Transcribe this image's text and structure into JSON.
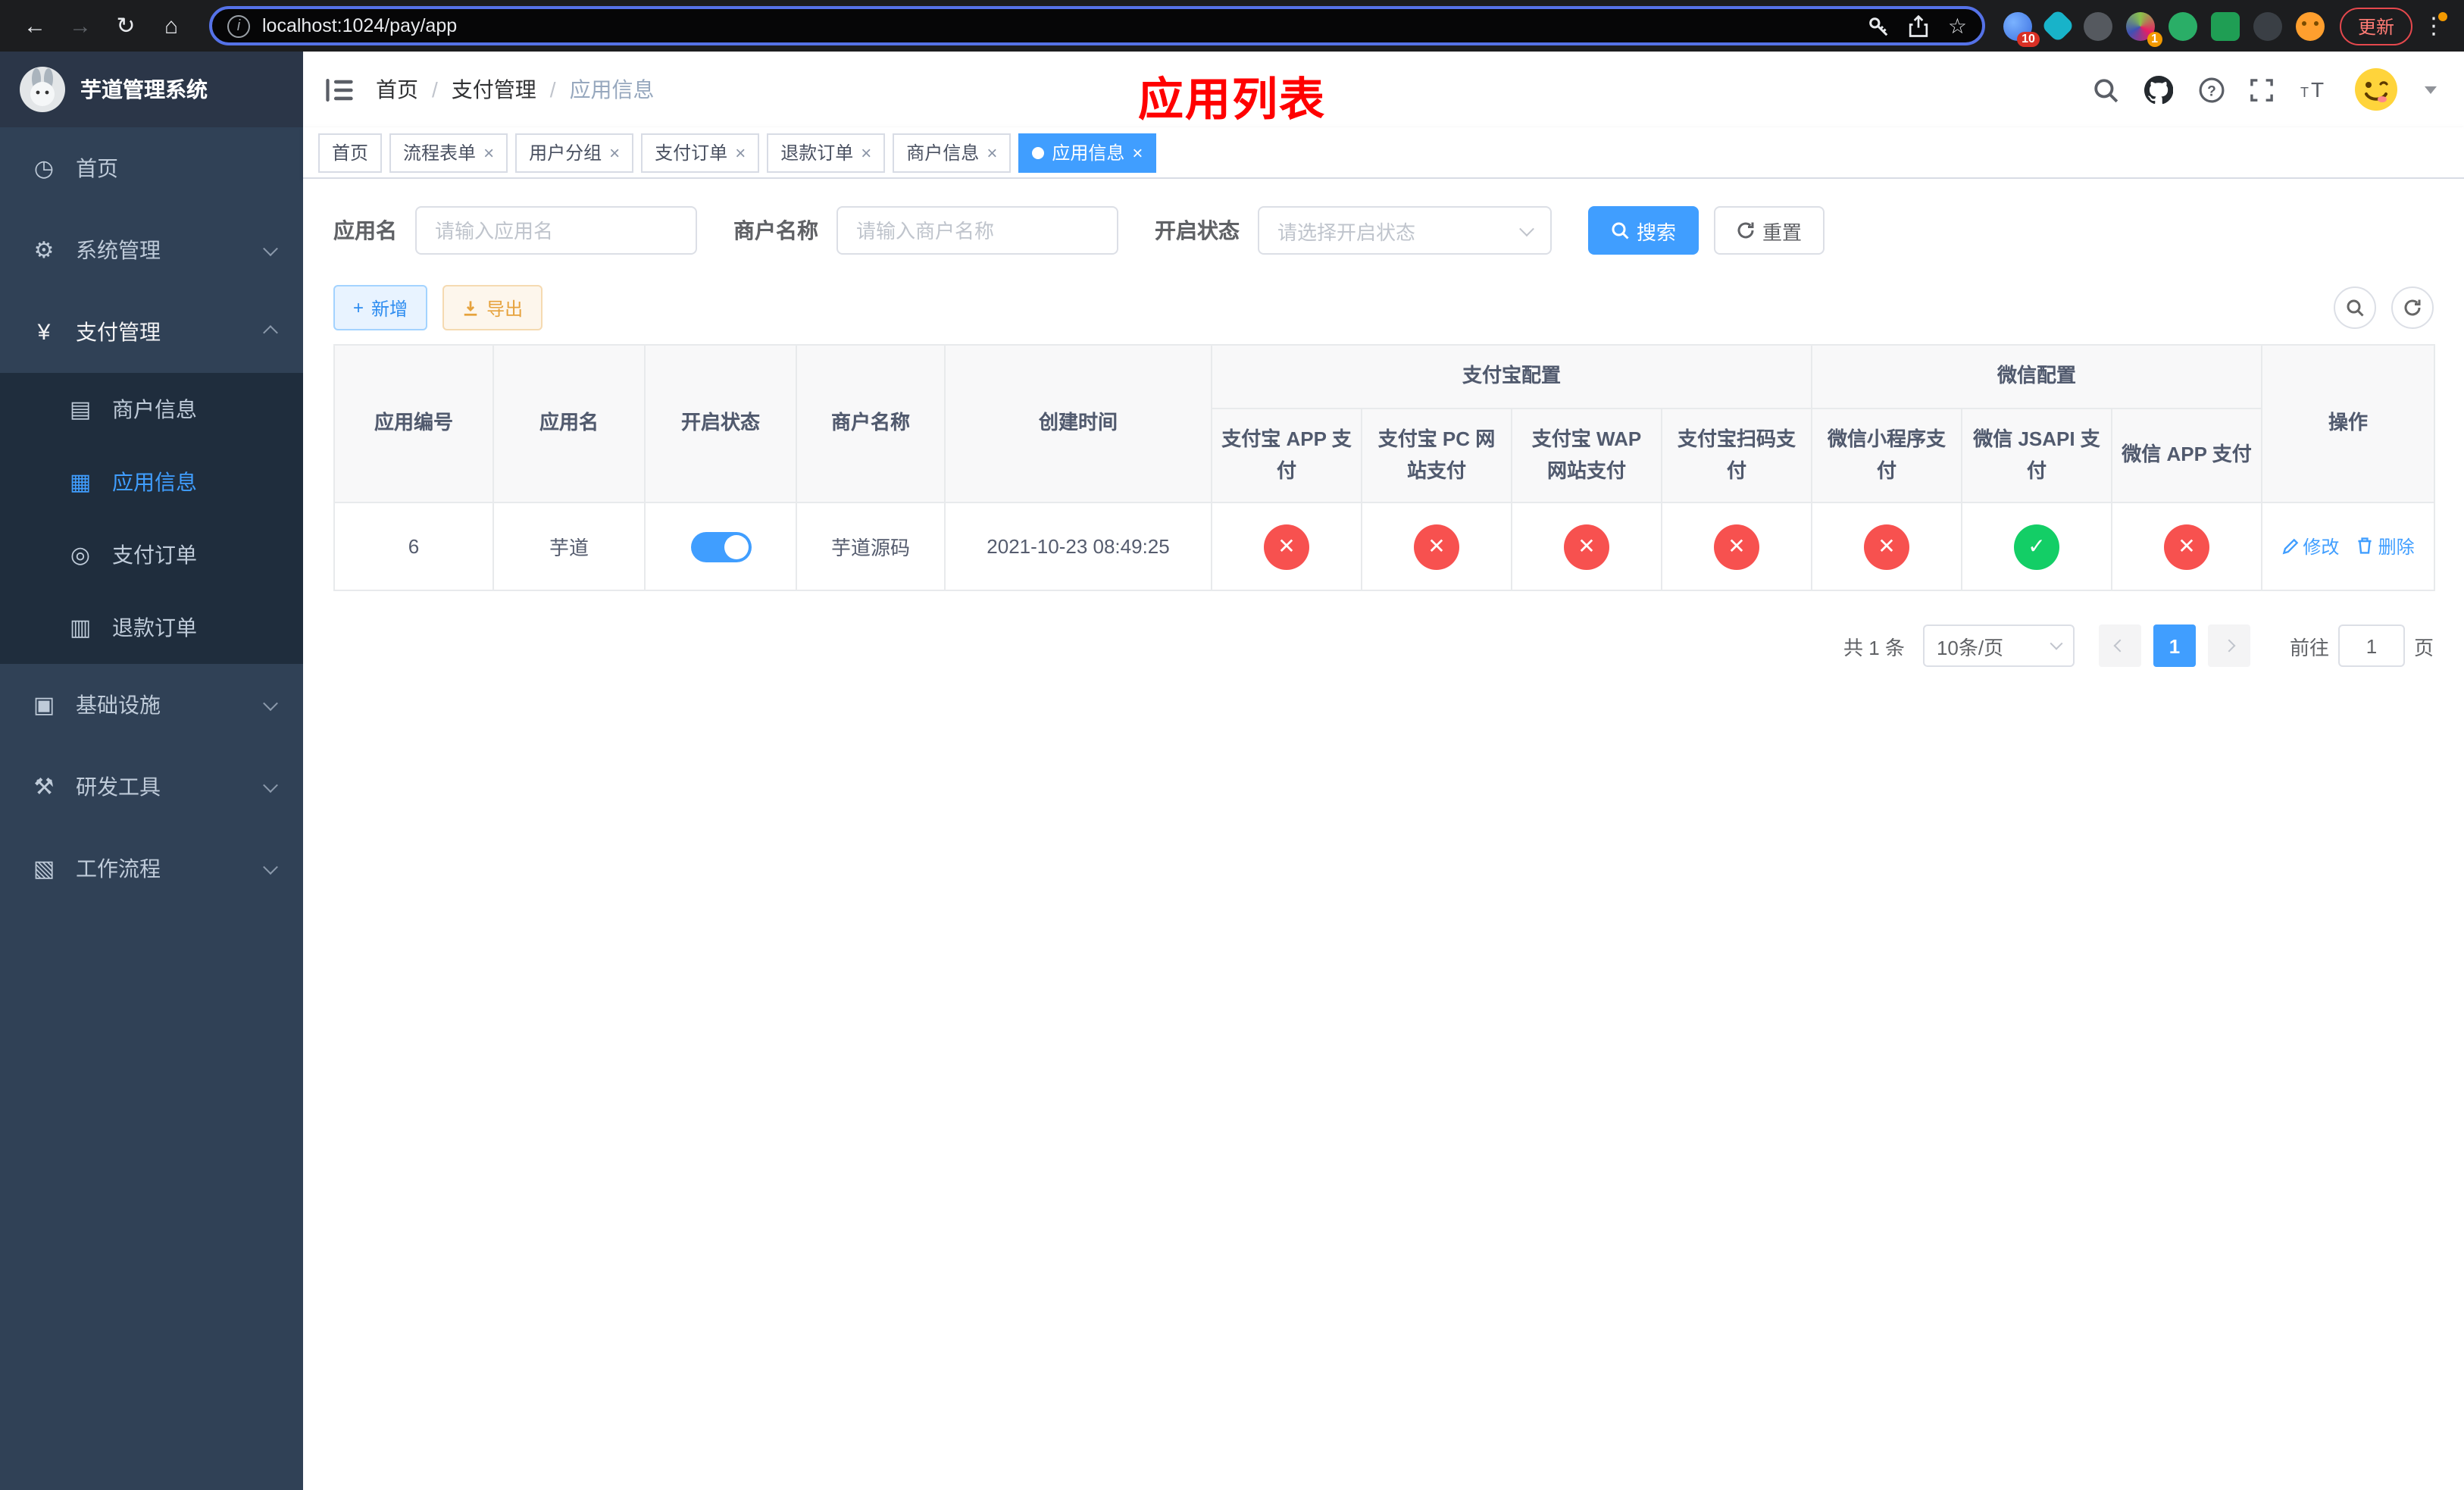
{
  "colors": {
    "primary": "#409eff",
    "success_circle": "#13ce66",
    "danger_circle": "#f7514f",
    "page_title_red": "#ff0000",
    "sidebar_bg": "#304156",
    "submenu_bg": "#1f2d3d",
    "tag_active_bg": "#409eff"
  },
  "browser": {
    "url": "localhost:1024/pay/app",
    "update_label": "更新",
    "extension_badge_1": "10",
    "extension_badge_2": "1"
  },
  "sidebar": {
    "title": "芋道管理系统",
    "items": [
      {
        "label": "首页",
        "icon": "dashboard-icon",
        "glyph": "◷"
      },
      {
        "label": "系统管理",
        "icon": "gear-icon",
        "glyph": "⚙"
      },
      {
        "label": "支付管理",
        "icon": "yen-icon",
        "glyph": "¥",
        "children": [
          {
            "label": "商户信息",
            "icon": "credit-card-icon",
            "glyph": "▤"
          },
          {
            "label": "应用信息",
            "icon": "grid-icon",
            "glyph": "▦"
          },
          {
            "label": "支付订单",
            "icon": "order-icon",
            "glyph": "◎"
          },
          {
            "label": "退款订单",
            "icon": "document-icon",
            "glyph": "▥"
          }
        ]
      },
      {
        "label": "基础设施",
        "icon": "infrastructure-icon",
        "glyph": "▣"
      },
      {
        "label": "研发工具",
        "icon": "tools-icon",
        "glyph": "⚒"
      },
      {
        "label": "工作流程",
        "icon": "workflow-icon",
        "glyph": "▧"
      }
    ]
  },
  "header": {
    "breadcrumb": [
      "首页",
      "支付管理",
      "应用信息"
    ],
    "page_title": "应用列表"
  },
  "tabs": [
    {
      "label": "首页"
    },
    {
      "label": "流程表单"
    },
    {
      "label": "用户分组"
    },
    {
      "label": "支付订单"
    },
    {
      "label": "退款订单"
    },
    {
      "label": "商户信息"
    },
    {
      "label": "应用信息"
    }
  ],
  "filters": {
    "app_name_label": "应用名",
    "app_name_placeholder": "请输入应用名",
    "merchant_label": "商户名称",
    "merchant_placeholder": "请输入商户名称",
    "status_label": "开启状态",
    "status_placeholder": "请选择开启状态",
    "search_label": "搜索",
    "reset_label": "重置"
  },
  "toolbar": {
    "add_label": "新增",
    "export_label": "导出"
  },
  "table": {
    "columns": {
      "id": "应用编号",
      "name": "应用名",
      "status": "开启状态",
      "merchant": "商户名称",
      "created": "创建时间",
      "actions": "操作"
    },
    "groups": {
      "alipay": "支付宝配置",
      "wechat": "微信配置"
    },
    "sub_columns": [
      "支付宝 APP 支付",
      "支付宝 PC 网站支付",
      "支付宝 WAP 网站支付",
      "支付宝扫码支付",
      "微信小程序支付",
      "微信 JSAPI 支付",
      "微信 APP 支付"
    ],
    "config_icons": {
      "yes": "✓",
      "no": "✕"
    },
    "rows": [
      {
        "id": "6",
        "name": "芋道",
        "status_on": true,
        "merchant": "芋道源码",
        "created": "2021-10-23 08:49:25",
        "configs": [
          "no",
          "no",
          "no",
          "no",
          "no",
          "yes",
          "no"
        ],
        "edit_label": "修改",
        "delete_label": "删除"
      }
    ]
  },
  "pagination": {
    "total": "共 1 条",
    "page_size": "10条/页",
    "page": "1",
    "goto_label": "前往",
    "goto_value": "1",
    "goto_suffix": "页"
  }
}
